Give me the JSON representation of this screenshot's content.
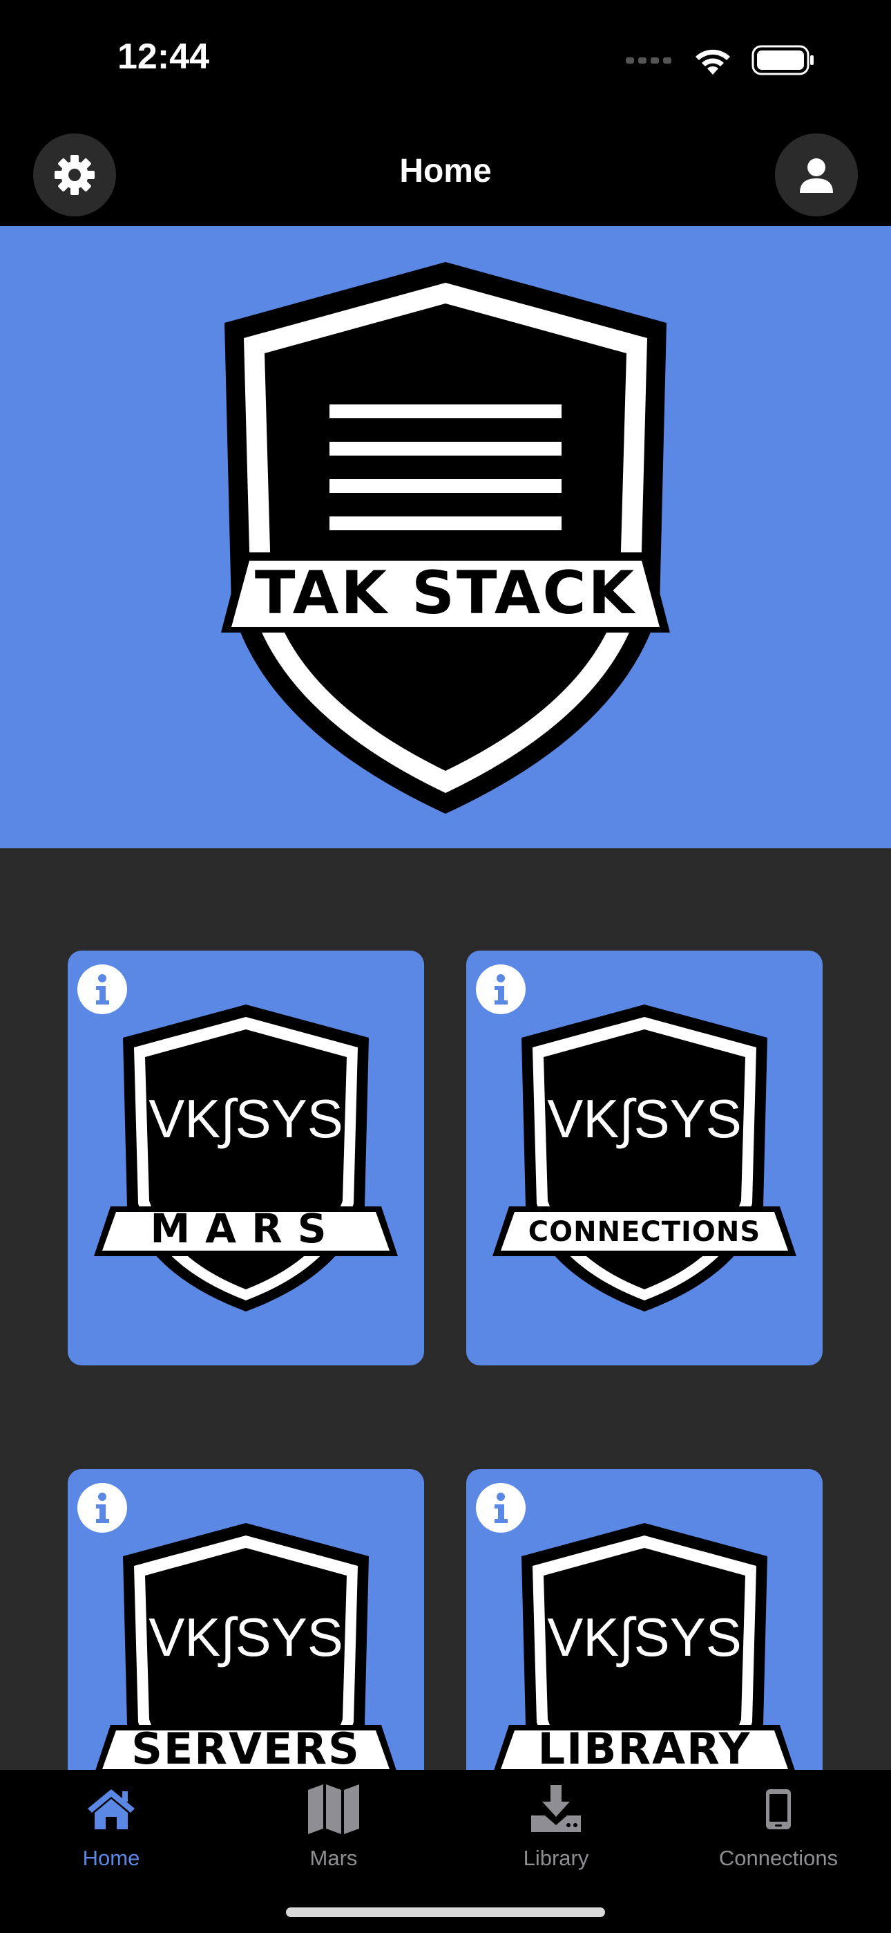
{
  "status_bar": {
    "time": "12:44"
  },
  "nav": {
    "title": "Home",
    "settings_icon": "gear-icon",
    "profile_icon": "person-icon"
  },
  "hero": {
    "logo_text": "TAK STACK"
  },
  "tiles": [
    {
      "brand": "VK∫SYS",
      "label": "MARS",
      "info_icon": "info-icon"
    },
    {
      "brand": "VK∫SYS",
      "label": "CONNECTIONS",
      "info_icon": "info-icon"
    },
    {
      "brand": "VK∫SYS",
      "label": "SERVERS",
      "info_icon": "info-icon"
    },
    {
      "brand": "VK∫SYS",
      "label": "LIBRARY",
      "info_icon": "info-icon"
    }
  ],
  "tab_bar": {
    "tabs": [
      {
        "label": "Home",
        "icon": "house-icon",
        "active": true
      },
      {
        "label": "Mars",
        "icon": "map-icon",
        "active": false
      },
      {
        "label": "Library",
        "icon": "download-icon",
        "active": false
      },
      {
        "label": "Connections",
        "icon": "phone-icon",
        "active": false
      }
    ]
  },
  "colors": {
    "accent": "#5a88e4",
    "background": "#2a2a2a",
    "bar": "#000000"
  }
}
